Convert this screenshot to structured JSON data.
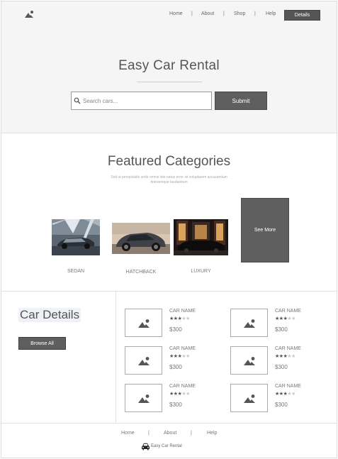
{
  "nav": {
    "links": [
      "Home",
      "About",
      "Shop",
      "Help"
    ],
    "separator": "|",
    "cta": "Details"
  },
  "hero": {
    "title": "Easy Car Rental",
    "search_placeholder": "Search cars...",
    "submit_label": "Submit"
  },
  "featured": {
    "title": "Featured Categories",
    "subtitle": "Sed ut perspiciatis unde omnis iste natus error sit voluptatem accusantium doloremque laudantium",
    "categories": [
      {
        "label": "SEDAN",
        "icon": "sedan-photo"
      },
      {
        "label": "HATCHBACK",
        "icon": "hatchback-photo"
      },
      {
        "label": "LUXURY",
        "icon": "luxury-photo"
      }
    ],
    "see_more": "See More"
  },
  "details": {
    "title": "Car Details",
    "browse_label": "Browse All",
    "listings": [
      {
        "name": "CAR NAME",
        "stars": "★★★★★",
        "rating": 3,
        "price": "$300"
      },
      {
        "name": "CAR NAME",
        "stars": "★★★★★",
        "rating": 3,
        "price": "$300"
      },
      {
        "name": "CAR NAME",
        "stars": "★★★★★",
        "rating": 3,
        "price": "$300"
      },
      {
        "name": "CAR NAME",
        "stars": "★★★★★",
        "rating": 3,
        "price": "$300"
      },
      {
        "name": "CAR NAME",
        "stars": "★★★★★",
        "rating": 3,
        "price": "$300"
      },
      {
        "name": "CAR  NAME",
        "stars": "★★★★★",
        "rating": 3,
        "price": "$300"
      }
    ]
  },
  "footer": {
    "links": [
      "Home",
      "About",
      "Help"
    ],
    "separator": "|",
    "brand": "Easy Car Rental"
  },
  "colors": {
    "button_dark": "#5f5f5f",
    "hero_bg": "#f5f5f5",
    "text": "#555555"
  }
}
